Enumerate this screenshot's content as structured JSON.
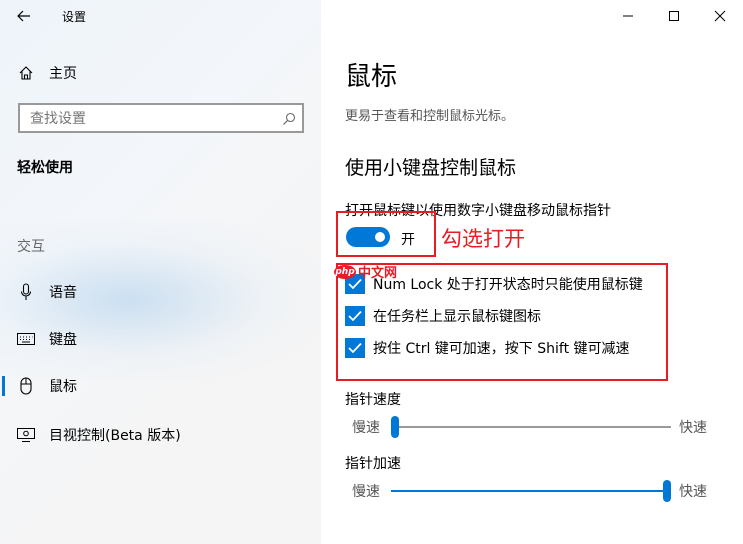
{
  "app": {
    "title": "设置"
  },
  "sidebar": {
    "home_label": "主页",
    "search_placeholder": "查找设置",
    "section_title": "轻松使用",
    "group_header": "交互",
    "items": [
      {
        "label": "语音",
        "icon": "microphone-icon"
      },
      {
        "label": "键盘",
        "icon": "keyboard-icon"
      },
      {
        "label": "鼠标",
        "icon": "mouse-icon",
        "active": true
      },
      {
        "label": "目视控制(Beta 版本)",
        "icon": "eye-control-icon"
      }
    ]
  },
  "main": {
    "title": "鼠标",
    "description": "更易于查看和控制鼠标光标。",
    "section_title": "使用小键盘控制鼠标",
    "toggle": {
      "label": "打开鼠标键以使用数字小键盘移动鼠标指针",
      "state": "开",
      "on": true
    },
    "checkboxes": [
      {
        "label": "Num Lock 处于打开状态时只能使用鼠标键",
        "checked": true
      },
      {
        "label": "在任务栏上显示鼠标键图标",
        "checked": true
      },
      {
        "label": "按住 Ctrl 键可加速，按下 Shift 键可减速",
        "checked": true
      }
    ],
    "sliders": [
      {
        "title": "指针速度",
        "min_label": "慢速",
        "max_label": "快速",
        "value_fraction": 0.0
      },
      {
        "title": "指针加速",
        "min_label": "慢速",
        "max_label": "快速",
        "value_fraction": 1.0
      }
    ]
  },
  "annotation": {
    "text": "勾选打开"
  },
  "watermark": {
    "logo": "php",
    "text": "中文网"
  },
  "colors": {
    "accent": "#0078d7",
    "annotation": "#e81c23"
  }
}
